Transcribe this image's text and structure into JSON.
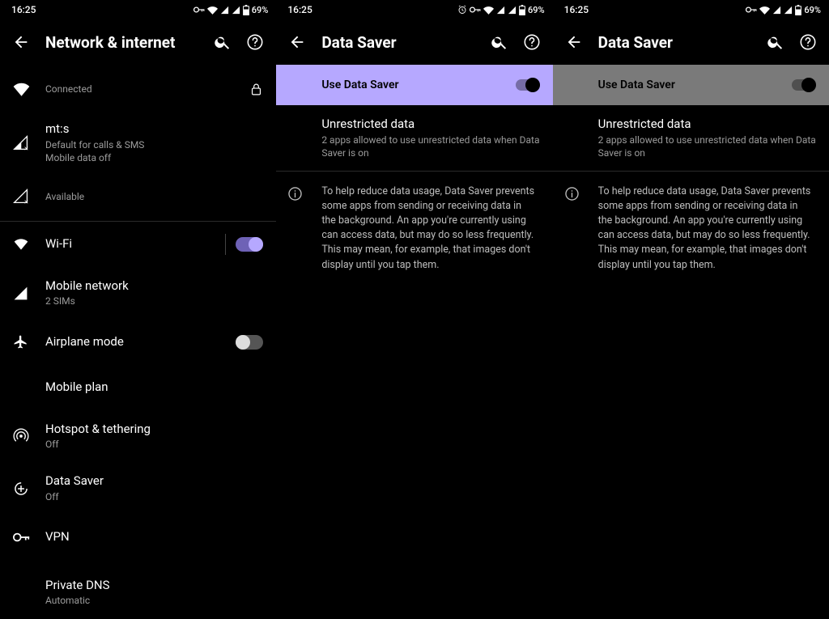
{
  "status": {
    "time": "16:25",
    "battery": "69%"
  },
  "screen1": {
    "title": "Network & internet",
    "wifi_row": {
      "secondary": "Connected"
    },
    "sim_row": {
      "primary": "mt:s",
      "secondary": "Default for calls & SMS\nMobile data off"
    },
    "available_row": {
      "secondary": "Available"
    },
    "wifi_entry": {
      "primary": "Wi-Fi"
    },
    "mobile_network": {
      "primary": "Mobile network",
      "secondary": "2 SIMs"
    },
    "airplane": {
      "primary": "Airplane mode"
    },
    "mobile_plan": {
      "primary": "Mobile plan"
    },
    "hotspot": {
      "primary": "Hotspot & tethering",
      "secondary": "Off"
    },
    "data_saver": {
      "primary": "Data Saver",
      "secondary": "Off"
    },
    "vpn": {
      "primary": "VPN"
    },
    "private_dns": {
      "primary": "Private DNS",
      "secondary": "Automatic"
    }
  },
  "screen2": {
    "title": "Data Saver",
    "master_label": "Use Data Saver",
    "unrestricted": {
      "primary": "Unrestricted data",
      "secondary": "2 apps allowed to use unrestricted data when Data Saver is on"
    },
    "info": "To help reduce data usage, Data Saver prevents some apps from sending or receiving data in the background. An app you're currently using can access data, but may do so less frequently. This may mean, for example, that images don't display until you tap them."
  },
  "screen3": {
    "title": "Data Saver",
    "master_label": "Use Data Saver",
    "unrestricted": {
      "primary": "Unrestricted data",
      "secondary": "2 apps allowed to use unrestricted data when Data Saver is on"
    },
    "info": "To help reduce data usage, Data Saver prevents some apps from sending or receiving data in the background. An app you're currently using can access data, but may do so less frequently. This may mean, for example, that images don't display until you tap them."
  }
}
